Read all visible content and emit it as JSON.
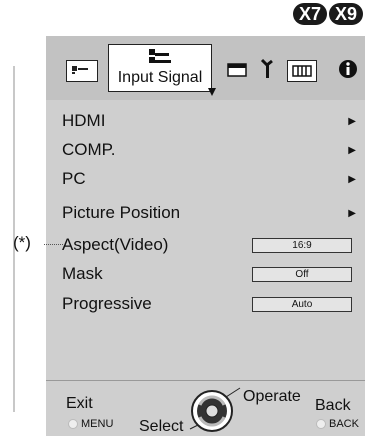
{
  "model_badges": [
    "X7",
    "X9"
  ],
  "tabs": {
    "active_label": "Input Signal"
  },
  "menu_items": [
    {
      "label": "HDMI",
      "has_submenu": true
    },
    {
      "label": "COMP.",
      "has_submenu": true
    },
    {
      "label": "PC",
      "has_submenu": true
    },
    {
      "label": "Picture Position",
      "has_submenu": true
    },
    {
      "label": "Aspect(Video)",
      "value": "16:9"
    },
    {
      "label": "Mask",
      "value": "Off"
    },
    {
      "label": "Progressive",
      "value": "Auto"
    }
  ],
  "annotation": "(*)",
  "footer": {
    "exit_label": "Exit",
    "exit_key": "MENU",
    "select_label": "Select",
    "operate_label": "Operate",
    "back_label": "Back",
    "back_key": "BACK"
  },
  "icons": [
    "picture-icon",
    "input-signal-icon",
    "installation-icon",
    "setup-icon",
    "display-icon",
    "info-icon"
  ]
}
